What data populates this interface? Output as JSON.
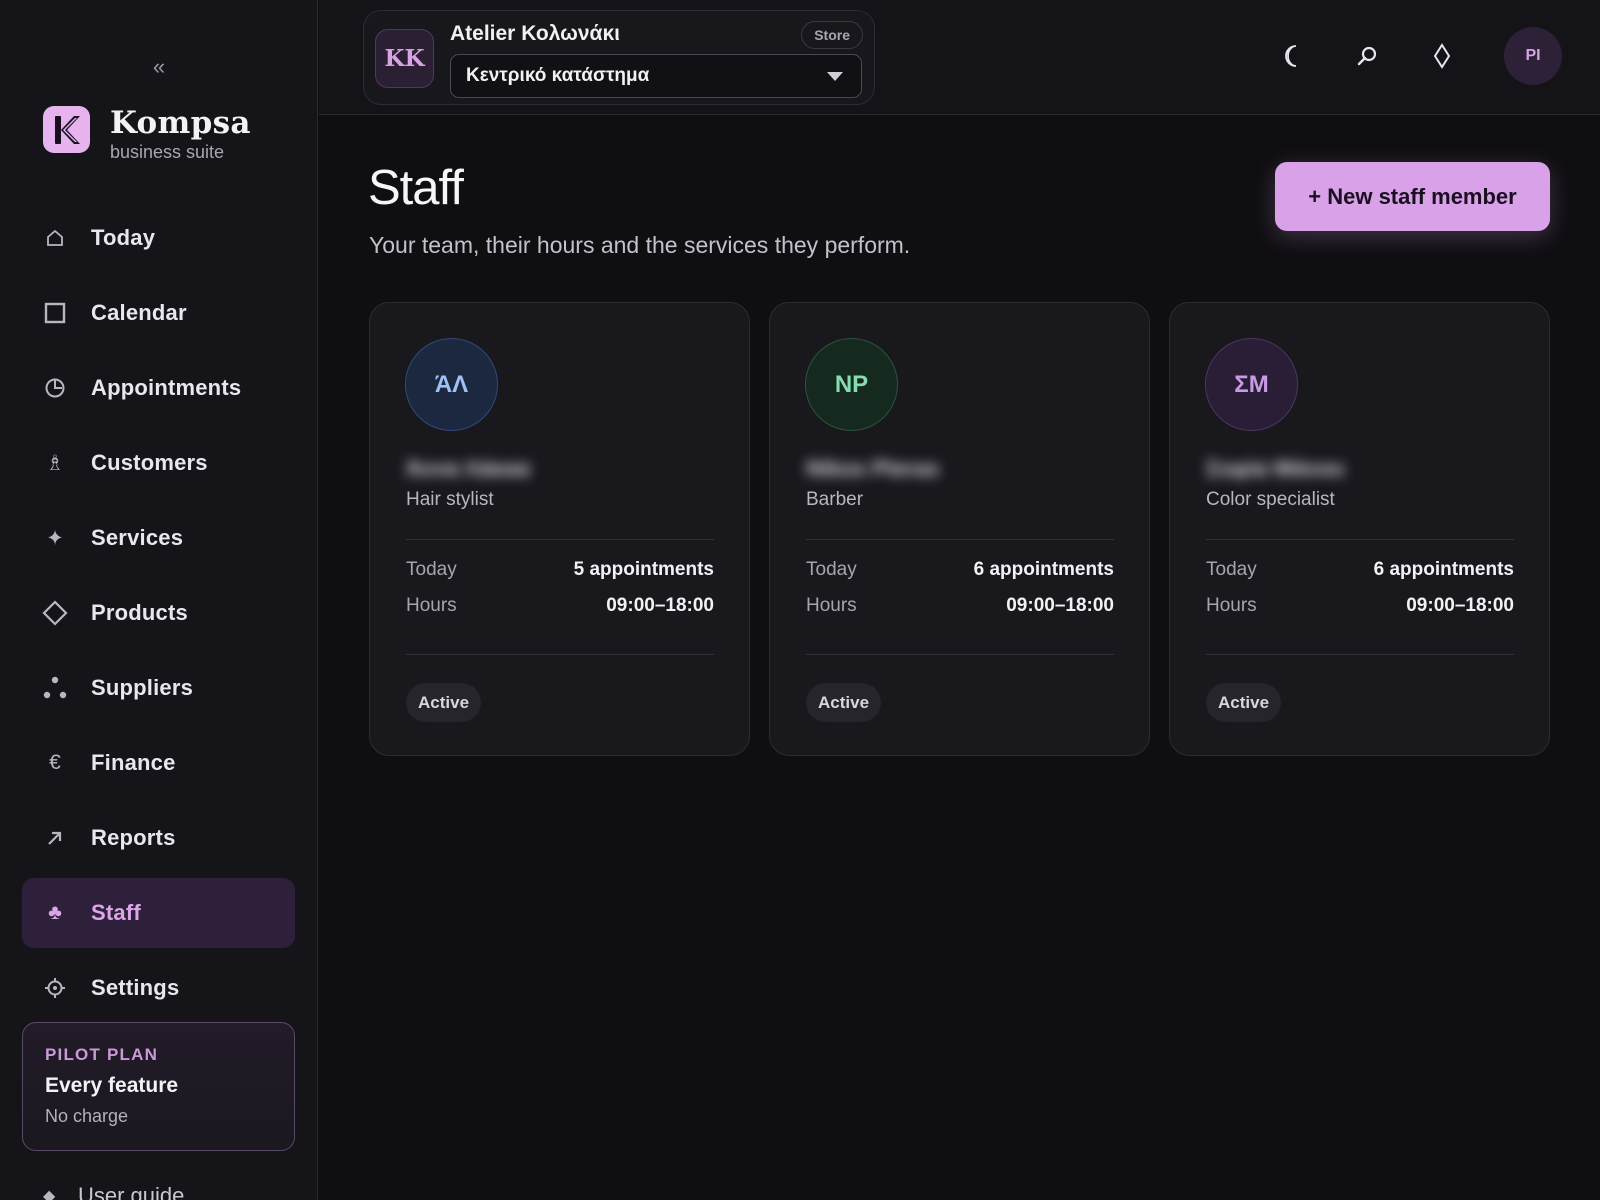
{
  "sidebar": {
    "collapse_glyph": "«",
    "brand": {
      "logo_letter": "K",
      "name": "Kompsa",
      "subtitle": "business suite"
    },
    "items": [
      {
        "label": "Today",
        "icon": "home-icon",
        "glyph": "⌂"
      },
      {
        "label": "Calendar",
        "icon": "calendar-icon",
        "glyph": "☐"
      },
      {
        "label": "Appointments",
        "icon": "clock-icon",
        "glyph": "◷"
      },
      {
        "label": "Customers",
        "icon": "person-icon",
        "glyph": "♗"
      },
      {
        "label": "Services",
        "icon": "sparkle-icon",
        "glyph": "✦"
      },
      {
        "label": "Products",
        "icon": "diamond-icon",
        "glyph": "◇"
      },
      {
        "label": "Suppliers",
        "icon": "dots-icon",
        "glyph": "∴"
      },
      {
        "label": "Finance",
        "icon": "euro-icon",
        "glyph": "€"
      },
      {
        "label": "Reports",
        "icon": "arrow-up-right-icon",
        "glyph": "↗"
      },
      {
        "label": "Staff",
        "icon": "staff-icon",
        "glyph": "♣"
      },
      {
        "label": "Settings",
        "icon": "gear-icon",
        "glyph": "⚙"
      }
    ],
    "active_item": "Staff",
    "plan": {
      "tag": "PILOT PLAN",
      "title": "Every feature",
      "subtitle": "No charge"
    },
    "user_guide": {
      "label": "User guide",
      "glyph": "◆"
    }
  },
  "topbar": {
    "store": {
      "avatar": "KK",
      "name": "Atelier Κολωνάκι",
      "badge": "Store",
      "selected_location": "Κεντρικό κατάστημα"
    },
    "actions": [
      {
        "icon": "moon-icon",
        "glyph": "☾"
      },
      {
        "icon": "search-icon",
        "glyph": "⌕"
      },
      {
        "icon": "diamond-outline-icon",
        "glyph": "◊"
      }
    ],
    "user_avatar": "PI"
  },
  "main": {
    "title": "Staff",
    "subtitle": "Your team, their hours and the services they perform.",
    "new_button": "+ New staff member",
    "staff": [
      {
        "initials": "ΆΛ",
        "name": "Άννα Λάκκα",
        "role": "Hair stylist",
        "today_label": "Today",
        "today_value": "5 appointments",
        "hours_label": "Hours",
        "hours_value": "09:00–18:00",
        "status": "Active",
        "avatar_bg": "#1c2740",
        "avatar_border": "#2f4a7a",
        "avatar_fg": "#9fc0f5"
      },
      {
        "initials": "NP",
        "name": "Nikos Pteras",
        "role": "Barber",
        "today_label": "Today",
        "today_value": "6 appointments",
        "hours_label": "Hours",
        "hours_value": "09:00–18:00",
        "status": "Active",
        "avatar_bg": "#15291f",
        "avatar_border": "#27563e",
        "avatar_fg": "#86dcb0"
      },
      {
        "initials": "ΣΜ",
        "name": "Σοφία Μάνου",
        "role": "Color specialist",
        "today_label": "Today",
        "today_value": "6 appointments",
        "hours_label": "Hours",
        "hours_value": "09:00–18:00",
        "status": "Active",
        "avatar_bg": "#2a1d36",
        "avatar_border": "#4d3563",
        "avatar_fg": "#c79be6"
      }
    ]
  },
  "colors": {
    "accent": "#d9a1e8",
    "background": "#0f0e11",
    "sidebar": "#151418",
    "card": "#19181d"
  }
}
